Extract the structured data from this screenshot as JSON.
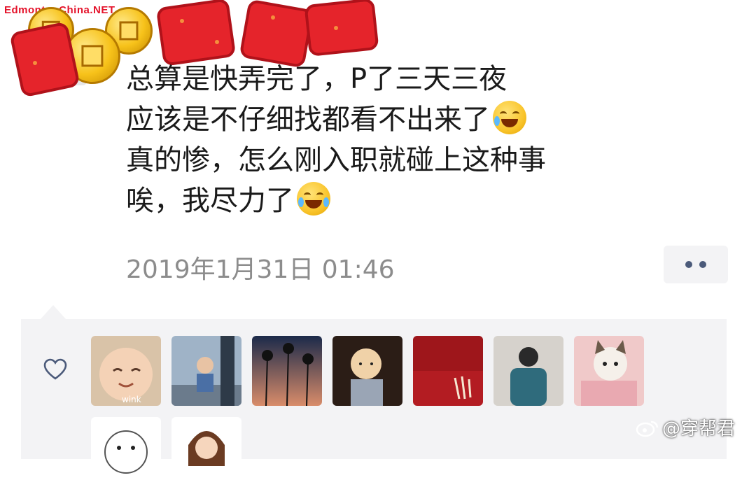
{
  "watermark_top": "EdmontonChina.NET",
  "post": {
    "lines": [
      "总算是快弄完了，P了三天三夜",
      "应该是不仔细找都看不出来了",
      "真的惨，怎么刚入职就碰上这种事",
      "唉，我尽力了"
    ],
    "emojis": [
      "face-with-tears-icon",
      "tears-of-joy-icon"
    ],
    "timestamp": "2019年1月31日 01:46"
  },
  "likes": {
    "avatars": [
      {
        "name": "wink-baby-avatar",
        "label": "wink"
      },
      {
        "name": "kid-street-avatar"
      },
      {
        "name": "palm-trees-sunset-avatar"
      },
      {
        "name": "cartoon-man-avatar"
      },
      {
        "name": "red-calligraphy-avatar"
      },
      {
        "name": "man-back-avatar"
      },
      {
        "name": "cat-avatar"
      },
      {
        "name": "seal-cartoon-avatar"
      },
      {
        "name": "girl-cartoon-avatar"
      }
    ]
  },
  "bottom_watermark": "@穿帮君",
  "colors": {
    "text": "#1a1a1a",
    "timestamp": "#8c8c8c",
    "panel_bg": "#f3f3f5",
    "accent_blue": "#4b5a7a",
    "sticker_red": "#e5242b"
  }
}
